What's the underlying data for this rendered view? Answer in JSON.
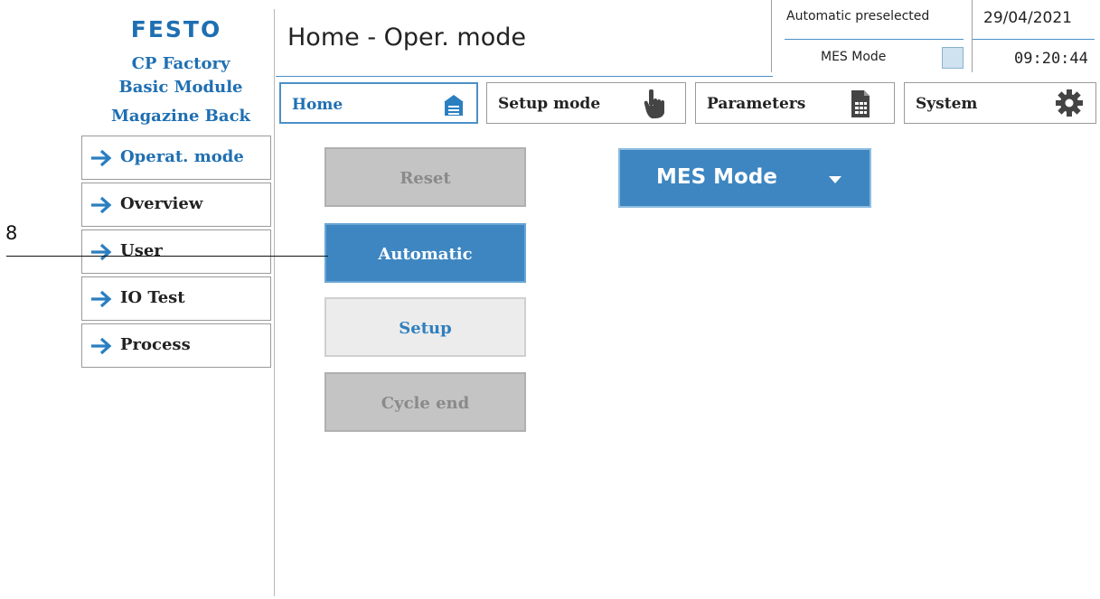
{
  "brand": {
    "logo": "FESTO",
    "line1": "CP Factory",
    "line2": "Basic Module",
    "line3": "Magazine Back"
  },
  "header": {
    "title": "Home - Oper. mode",
    "automatic_preselected": "Automatic preselected",
    "mes_mode_label": "MES Mode",
    "date": "29/04/2021",
    "time": "09:20:44"
  },
  "nav": {
    "home": "Home",
    "setup_mode": "Setup mode",
    "parameters": "Parameters",
    "system": "System"
  },
  "menu": {
    "items": [
      {
        "label": "Operat. mode"
      },
      {
        "label": "Overview"
      },
      {
        "label": "User"
      },
      {
        "label": "IO Test"
      },
      {
        "label": "Process"
      }
    ]
  },
  "actions": {
    "reset": "Reset",
    "automatic": "Automatic",
    "setup": "Setup",
    "cycle_end": "Cycle end"
  },
  "mode_select": {
    "value": "MES Mode"
  },
  "callout": {
    "number": "8"
  },
  "colors": {
    "accent": "#3d86c1",
    "brand": "#1f6fb2",
    "disabled": "#c4c4c4",
    "indicator": "#cfe2ef"
  }
}
